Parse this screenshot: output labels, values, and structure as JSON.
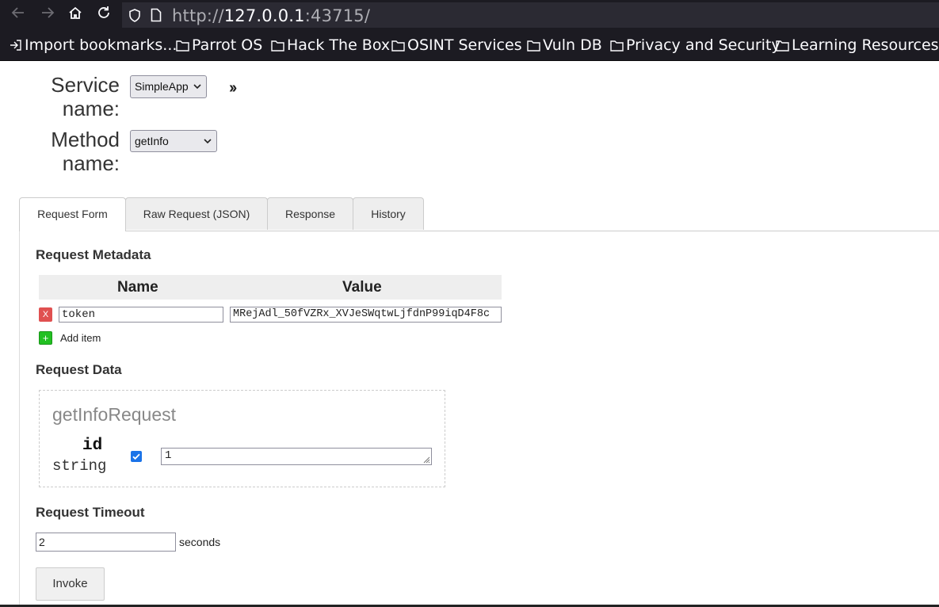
{
  "browser": {
    "url_prefix": "http://",
    "url_host": "127.0.0.1",
    "url_port_path": ":43715/",
    "bookmarks": [
      {
        "label": "Import bookmarks..."
      },
      {
        "label": "Parrot OS"
      },
      {
        "label": "Hack The Box"
      },
      {
        "label": "OSINT Services"
      },
      {
        "label": "Vuln DB"
      },
      {
        "label": "Privacy and Security"
      },
      {
        "label": "Learning Resources"
      }
    ]
  },
  "service": {
    "service_label_1": "Service",
    "service_label_2": "name:",
    "service_value": "SimpleApp",
    "method_label_1": "Method",
    "method_label_2": "name:",
    "method_value": "getInfo",
    "chevron": "››"
  },
  "tabs": [
    {
      "label": "Request Form",
      "active": true
    },
    {
      "label": "Raw Request (JSON)"
    },
    {
      "label": "Response"
    },
    {
      "label": "History"
    }
  ],
  "metadata": {
    "heading": "Request Metadata",
    "col_name": "Name",
    "col_value": "Value",
    "rows": [
      {
        "remove": "X",
        "name": "token",
        "value": "MRejAdl_50fVZRx_XVJeSWqtwLjfdnP99iqD4F8c"
      }
    ],
    "add_icon": "+",
    "add_label": "Add item"
  },
  "request_data": {
    "heading": "Request Data",
    "message_name": "getInfoRequest",
    "field_name": "id",
    "field_type": "string",
    "field_enabled": true,
    "field_value": "1"
  },
  "timeout": {
    "heading": "Request Timeout",
    "value": "2",
    "unit": "seconds"
  },
  "invoke_label": "Invoke",
  "colors": {
    "chrome_bg": "#1c1b22",
    "remove_red": "#e05050",
    "add_green": "#22c022",
    "checkbox_blue": "#1a73e8"
  }
}
